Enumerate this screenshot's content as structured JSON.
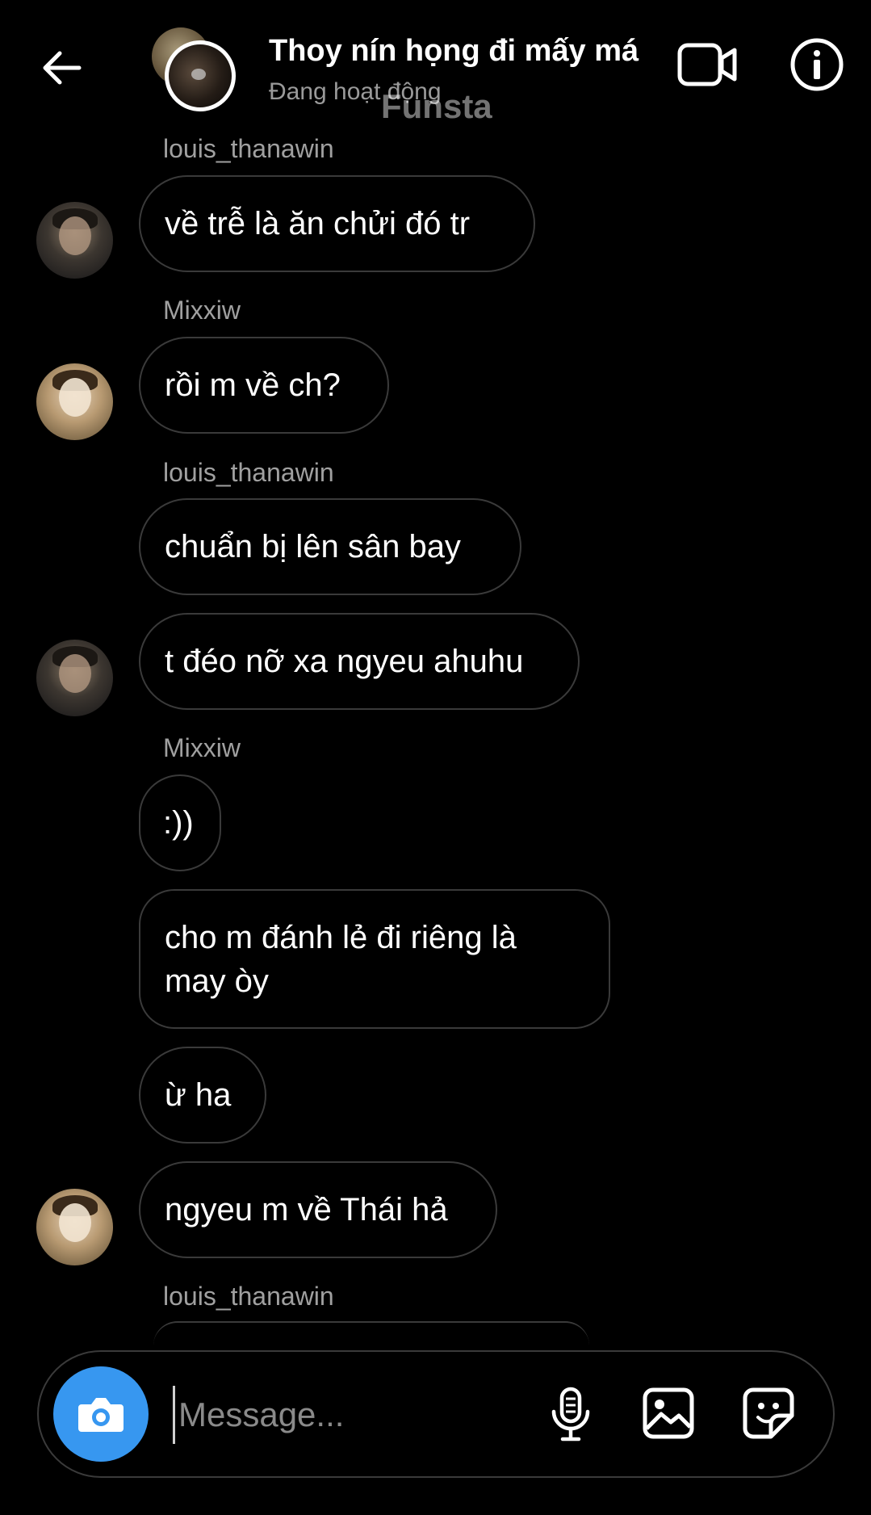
{
  "header": {
    "title": "Thoy nín họng đi mấy má",
    "status": "Đang hoạt động",
    "watermark": "Funsta",
    "icons": {
      "back": "arrow-left-icon",
      "video": "video-camera-icon",
      "info": "info-icon"
    }
  },
  "messages": [
    {
      "sender": "louis_thanawin"
    },
    {
      "text": "về trễ là ăn chửi đó tr"
    },
    {
      "sender": "Mixxiw"
    },
    {
      "text": "rồi m về ch?"
    },
    {
      "sender": "louis_thanawin"
    },
    {
      "text": "chuẩn bị lên sân bay"
    },
    {
      "text": "t đéo nỡ xa ngyeu ahuhu"
    },
    {
      "sender": "Mixxiw"
    },
    {
      "text": ":))"
    },
    {
      "text": "cho m đánh lẻ đi riêng là may òy"
    },
    {
      "text": "ừ ha"
    },
    {
      "text": "ngyeu m về Thái hả"
    },
    {
      "sender": "louis_thanawin"
    }
  ],
  "composer": {
    "placeholder": "Message...",
    "accent": "#3797f0",
    "icons": {
      "camera": "camera-icon",
      "mic": "microphone-icon",
      "gallery": "gallery-icon",
      "sticker": "sticker-icon"
    }
  }
}
